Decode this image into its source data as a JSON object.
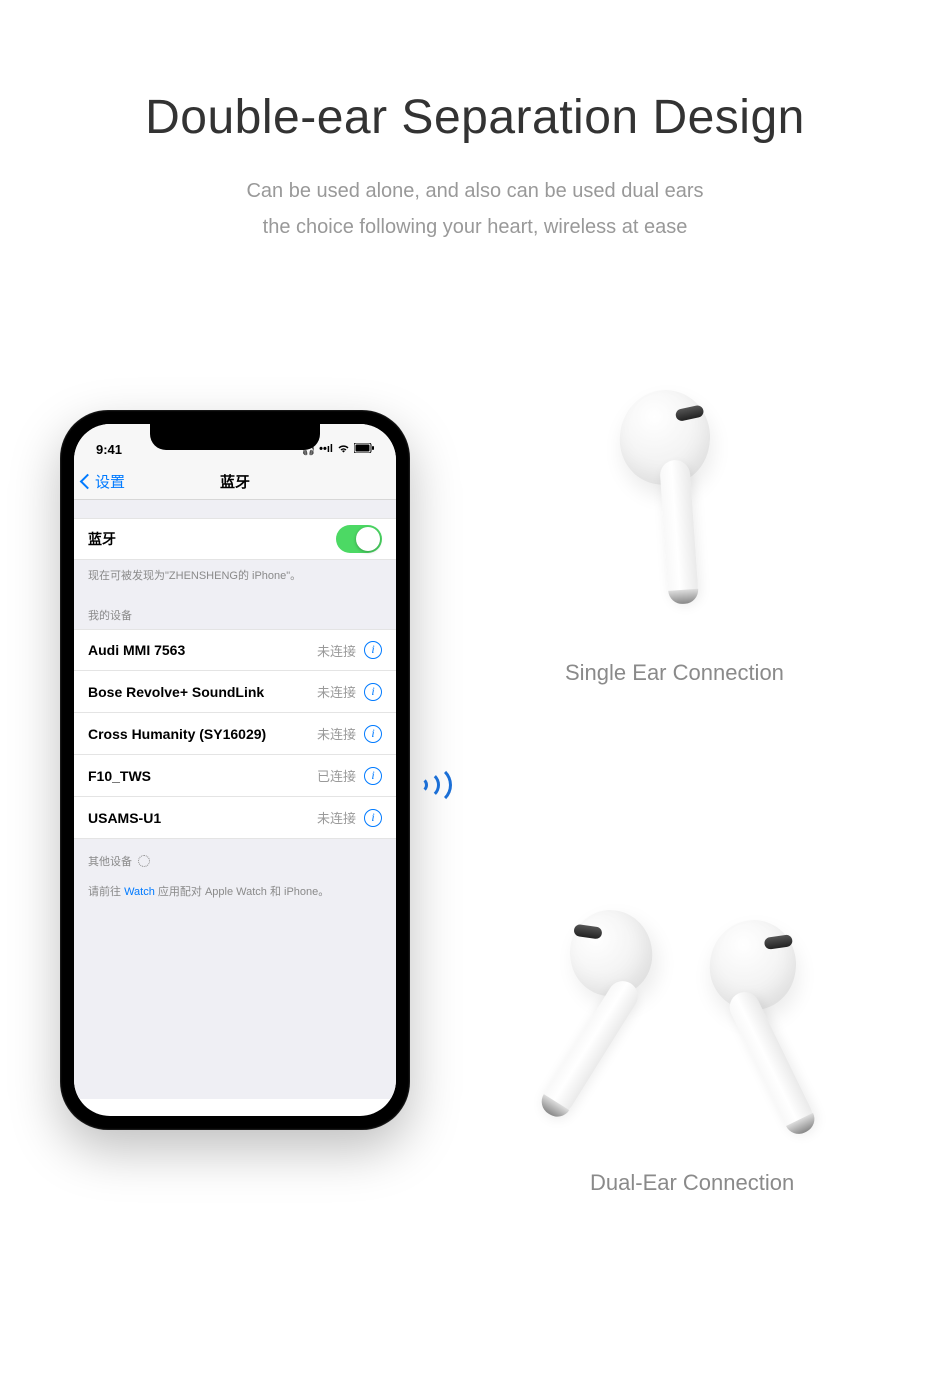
{
  "hero": {
    "title": "Double-ear Separation Design",
    "sub1": "Can be used alone, and also can be used dual ears",
    "sub2": "the choice following your heart, wireless at ease"
  },
  "phone": {
    "time": "9:41",
    "back": "设置",
    "title": "蓝牙",
    "bt_label": "蓝牙",
    "discover_note": "现在可被发现为\"ZHENSHENG的 iPhone\"。",
    "my_devices": "我的设备",
    "devices": [
      {
        "name": "Audi MMI 7563",
        "status": "未连接"
      },
      {
        "name": "Bose Revolve+ SoundLink",
        "status": "未连接"
      },
      {
        "name": "Cross Humanity (SY16029)",
        "status": "未连接"
      },
      {
        "name": "F10_TWS",
        "status": "已连接"
      },
      {
        "name": "USAMS-U1",
        "status": "未连接"
      }
    ],
    "other_devices": "其他设备",
    "footer_pre": "请前往 ",
    "footer_link": "Watch",
    "footer_post": " 应用配对 Apple Watch 和 iPhone。"
  },
  "captions": {
    "single": "Single Ear Connection",
    "dual": "Dual-Ear Connection"
  }
}
